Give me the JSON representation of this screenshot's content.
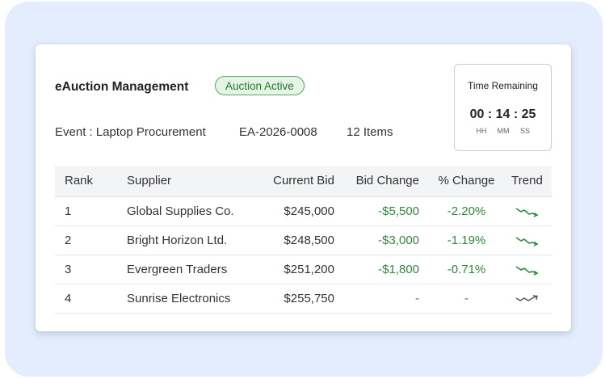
{
  "header": {
    "title": "eAuction Management",
    "status": "Auction Active"
  },
  "event": {
    "label": "Event : Laptop Procurement",
    "id": "EA-2026-0008",
    "items": "12 Items"
  },
  "timer": {
    "title": "Time Remaining",
    "value": "00 : 14 : 25",
    "units": [
      "HH",
      "MM",
      "SS"
    ]
  },
  "table": {
    "columns": [
      "Rank",
      "Supplier",
      "Current Bid",
      "Bid Change",
      "% Change",
      "Trend"
    ],
    "rows": [
      {
        "rank": "1",
        "supplier": "Global Supplies Co.",
        "bid": "$245,000",
        "change": "-$5,500",
        "pct": "-2.20%",
        "trend": "trend-down-icon"
      },
      {
        "rank": "2",
        "supplier": "Bright Horizon Ltd.",
        "bid": "$248,500",
        "change": "-$3,000",
        "pct": "-1.19%",
        "trend": "trend-down-icon"
      },
      {
        "rank": "3",
        "supplier": "Evergreen Traders",
        "bid": "$251,200",
        "change": "-$1,800",
        "pct": "-0.71%",
        "trend": "trend-down-icon"
      },
      {
        "rank": "4",
        "supplier": "Sunrise Electronics",
        "bid": "$255,750",
        "change": "-",
        "pct": "-",
        "trend": "trend-up-icon"
      }
    ]
  },
  "colors": {
    "background": "#e3edfd",
    "negative": "#2e8b3a",
    "badge_border": "#5aa85f",
    "badge_fill": "#e6f4e6",
    "neutral_trend": "#555555"
  }
}
